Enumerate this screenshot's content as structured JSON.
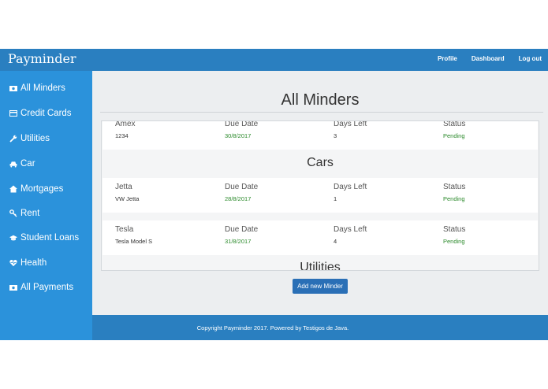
{
  "navbar": {
    "brand": "Payminder",
    "links": [
      "Profile",
      "Dashboard",
      "Log out"
    ]
  },
  "sidebar": {
    "items": [
      {
        "icon": "money-icon",
        "label": "All Minders"
      },
      {
        "icon": "credit-card-icon",
        "label": "Credit Cards"
      },
      {
        "icon": "wrench-icon",
        "label": "Utilities"
      },
      {
        "icon": "car-icon",
        "label": "Car"
      },
      {
        "icon": "home-icon",
        "label": "Mortgages"
      },
      {
        "icon": "key-icon",
        "label": "Rent"
      },
      {
        "icon": "graduation-cap-icon",
        "label": "Student Loans"
      },
      {
        "icon": "heartbeat-icon",
        "label": "Health"
      },
      {
        "icon": "money-icon",
        "label": "All Payments"
      }
    ]
  },
  "main": {
    "title": "All Minders",
    "add_button": "Add new Minder",
    "columns": {
      "due": "Due Date",
      "days": "Days Left",
      "status": "Status"
    },
    "top_card": {
      "name": "Amex",
      "sub": "1234",
      "due": "30/8/2017",
      "days": "3",
      "status": "Pending"
    },
    "sections": [
      {
        "heading": "Cars",
        "cards": [
          {
            "name": "Jetta",
            "sub": "VW Jetta",
            "due": "28/8/2017",
            "days": "1",
            "status": "Pending"
          },
          {
            "name": "Tesla",
            "sub": "Tesla Model S",
            "due": "31/8/2017",
            "days": "4",
            "status": "Pending"
          }
        ]
      },
      {
        "heading": "Utilities"
      }
    ]
  },
  "footer": {
    "text": "Copyright Payminder 2017. Powered by Testigos de Java."
  },
  "colors": {
    "nav": "#2a7fc0",
    "sidebar": "#2b92db",
    "status_green": "#2b8a2b",
    "button": "#2a6fb6"
  }
}
